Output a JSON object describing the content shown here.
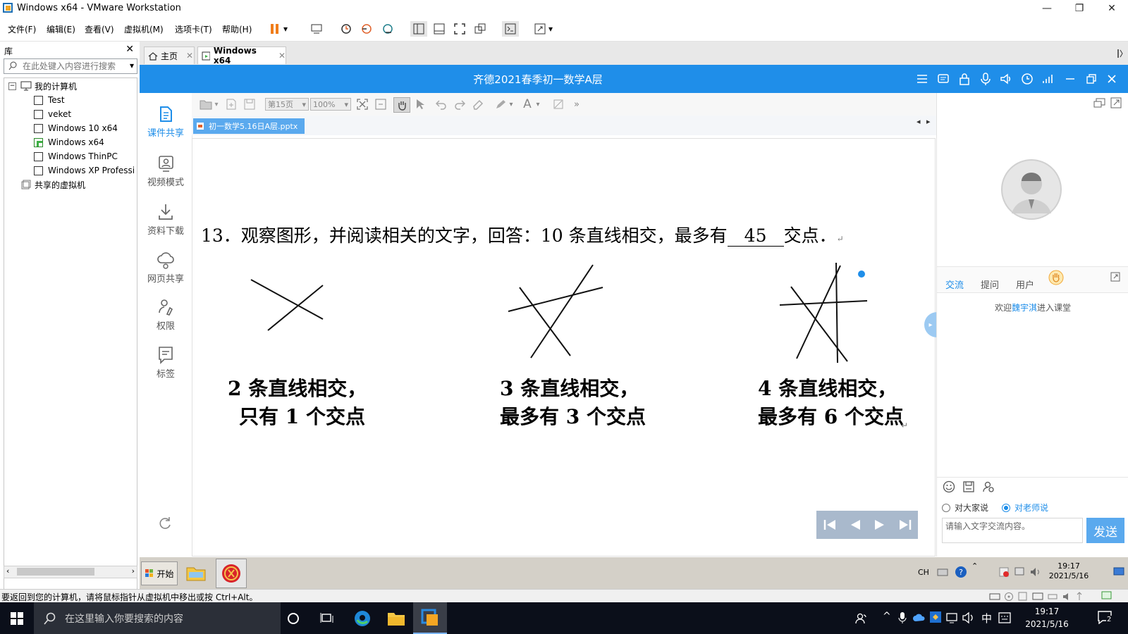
{
  "window": {
    "title": "Windows x64 - VMware Workstation"
  },
  "menu": [
    "文件(F)",
    "编辑(E)",
    "查看(V)",
    "虚拟机(M)",
    "选项卡(T)",
    "帮助(H)"
  ],
  "library": {
    "title": "库",
    "search_placeholder": "在此处键入内容进行搜索",
    "root": "我的计算机",
    "vms": [
      "Test",
      "veket",
      "Windows 10 x64",
      "Windows x64",
      "Windows ThinPC",
      "Windows XP Professi"
    ],
    "shared": "共享的虚拟机"
  },
  "tabs": [
    {
      "label": "主页"
    },
    {
      "label": "Windows x64"
    }
  ],
  "app": {
    "title": "齐德2021春季初一数学A层",
    "nav": [
      {
        "label": "课件共享",
        "icon": "doc-share-icon",
        "active": true
      },
      {
        "label": "视频模式",
        "icon": "video-mode-icon"
      },
      {
        "label": "资料下载",
        "icon": "download-icon"
      },
      {
        "label": "网页共享",
        "icon": "web-share-icon"
      },
      {
        "label": "权限",
        "icon": "permission-icon"
      },
      {
        "label": "标签",
        "icon": "bookmark-icon"
      }
    ],
    "toolbar": {
      "page": "第15页",
      "zoom": "100%"
    },
    "document_tab": "初一数学5.16日A层.pptx",
    "slide": {
      "question_before": "13．观察图形，并阅读相关的文字，回答：10 条直线相交，最多有",
      "answer": "45",
      "question_after": "交点．",
      "figures": [
        {
          "line1": "2 条直线相交，",
          "line2": "只有 1 个交点"
        },
        {
          "line1": "3 条直线相交，",
          "line2": "最多有 3 个交点"
        },
        {
          "line1": "4 条直线相交，",
          "line2": "最多有 6 个交点"
        }
      ]
    },
    "chat": {
      "tabs": [
        "交流",
        "提问",
        "用户"
      ],
      "welcome_prefix": "欢迎",
      "welcome_user": "魏宇淇",
      "welcome_suffix": "进入课堂",
      "to_all": "对大家说",
      "to_teacher": "对老师说",
      "input_placeholder": "请输入文字交流内容。",
      "send": "发送"
    }
  },
  "guest_taskbar": {
    "start": "开始",
    "lang": "CH",
    "time": "19:17",
    "date": "2021/5/16"
  },
  "vm_status": "要返回到您的计算机，请将鼠标指针从虚拟机中移出或按 Ctrl+Alt。",
  "host_taskbar": {
    "search_placeholder": "在这里输入你要搜索的内容",
    "ime": "中",
    "time": "19:17",
    "date": "2021/5/16",
    "notification_count": "2"
  },
  "colors": {
    "accent": "#1f8ee9",
    "pause": "#f07d1a"
  }
}
